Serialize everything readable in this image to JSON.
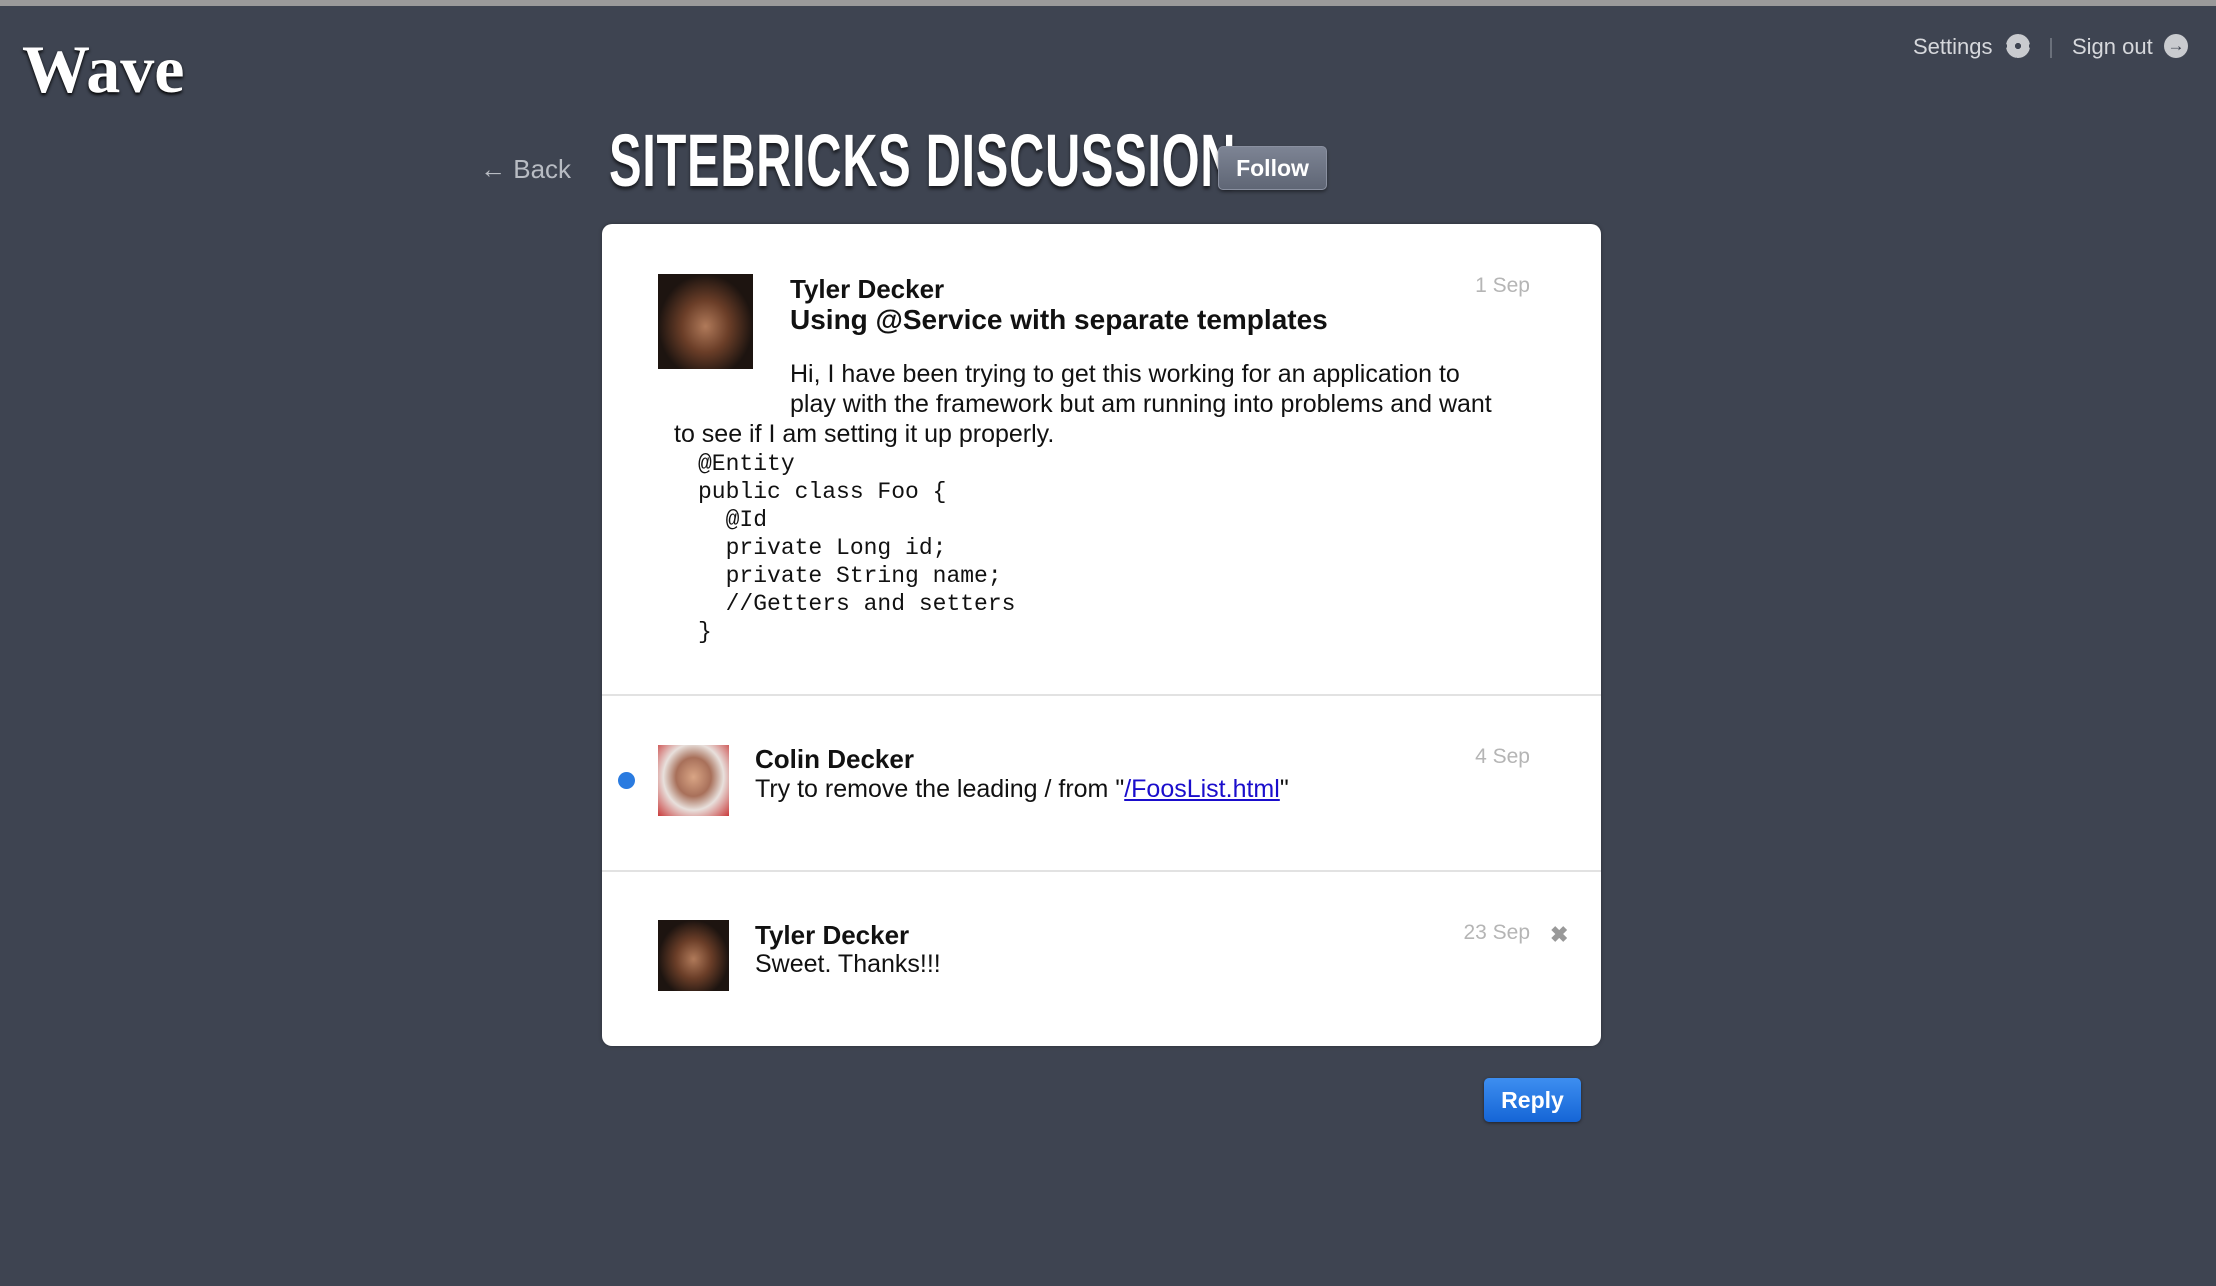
{
  "app": {
    "logo": "Wave"
  },
  "header": {
    "settings": "Settings",
    "sign_out": "Sign out",
    "settings_icon": "gear-icon",
    "sign_out_icon": "arrow-circle-icon"
  },
  "wave": {
    "back": "← Back",
    "title": "SITEBRICKS DISCUSSION",
    "follow": "Follow"
  },
  "posts": [
    {
      "author": "Tyler Decker",
      "subject": "Using @Service with separate templates",
      "date": "1 Sep",
      "body_lines": [
        "Hi, I have been trying to get this working for an application to",
        "play with the framework but am running into problems and want",
        "to see if I am setting it up properly."
      ],
      "code": [
        "@Entity",
        "public class Foo {",
        "  @Id",
        "  private Long id;",
        "  private String name;",
        "  //Getters and setters",
        "}"
      ]
    },
    {
      "author": "Colin Decker",
      "date": "4 Sep",
      "unread": true,
      "text_before": "Try to remove the leading / from \"",
      "link": "/FoosList.html",
      "text_after": "\""
    },
    {
      "author": "Tyler Decker",
      "date": "23 Sep",
      "text": "Sweet. Thanks!!!"
    }
  ],
  "reply": "Reply",
  "colors": {
    "background": "#3e4451",
    "accent": "#1f74e3",
    "unread_dot": "#2a7be0"
  }
}
